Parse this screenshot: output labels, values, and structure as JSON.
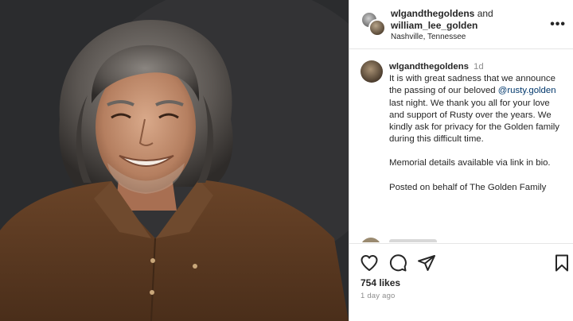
{
  "header": {
    "user1": "wlgandthegoldens",
    "and_text": "and",
    "user2": "william_lee_golden",
    "location": "Nashville, Tennessee",
    "more_label": "•••"
  },
  "caption": {
    "username": "wlgandthegoldens",
    "time": "1d",
    "text_part1": "It is with great sadness that we announce the passing of our beloved ",
    "mention": "@rusty.golden",
    "text_part2": " last night. We thank you all for your love and support of Rusty over the years. We kindly ask for privacy for the Golden family during this difficult time.",
    "paragraph2": "Memorial details available via link in bio.",
    "paragraph3": "Posted on behalf of The Golden Family"
  },
  "actions": {
    "like_icon": "heart-icon",
    "comment_icon": "comment-icon",
    "share_icon": "share-icon",
    "save_icon": "bookmark-icon",
    "likes": "754 likes",
    "posted_ago": "1 day ago"
  },
  "colors": {
    "mention": "#00376b",
    "muted": "#8e8e8e",
    "shirt": "#5b3a22",
    "background": "#2a2b2d"
  }
}
